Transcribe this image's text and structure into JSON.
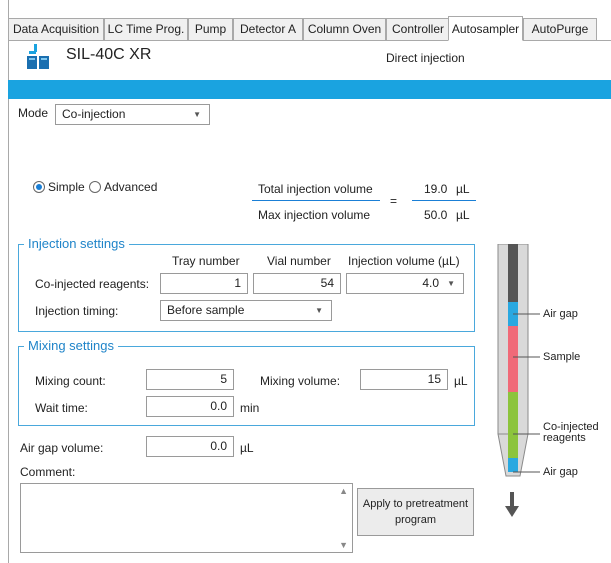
{
  "tabs": [
    "Data Acquisition",
    "LC Time Prog.",
    "Pump",
    "Detector A",
    "Column Oven",
    "Controller",
    "Autosampler",
    "AutoPurge"
  ],
  "device": {
    "name": "SIL-40C XR",
    "injection_mode": "Direct injection"
  },
  "mode": {
    "label": "Mode",
    "value": "Co-injection"
  },
  "method_type": {
    "simple_label": "Simple",
    "advanced_label": "Advanced",
    "selected": "Simple"
  },
  "volumes": {
    "total_label": "Total injection volume",
    "total_value": "19.0",
    "max_label": "Max injection volume",
    "max_value": "50.0",
    "unit": "µL",
    "equals": "="
  },
  "injection_settings": {
    "title": "Injection settings",
    "col_tray": "Tray number",
    "col_vial": "Vial number",
    "col_volume": "Injection volume (µL)",
    "coinj_label": "Co-injected reagents:",
    "tray_value": "1",
    "vial_value": "54",
    "volume_value": "4.0",
    "timing_label": "Injection timing:",
    "timing_value": "Before sample"
  },
  "mixing_settings": {
    "title": "Mixing settings",
    "count_label": "Mixing count:",
    "count_value": "5",
    "volume_label": "Mixing volume:",
    "volume_value": "15",
    "volume_unit": "µL",
    "wait_label": "Wait time:",
    "wait_value": "0.0",
    "wait_unit": "min"
  },
  "air_gap": {
    "label": "Air gap volume:",
    "value": "0.0",
    "unit": "µL"
  },
  "comment": {
    "label": "Comment:",
    "value": ""
  },
  "apply_button": {
    "line1": "Apply to pretreatment",
    "line2": "program"
  },
  "needle_legend": {
    "air_gap_top": "Air gap",
    "sample": "Sample",
    "coinj_line1": "Co-injected",
    "coinj_line2": "reagents",
    "air_gap_bottom": "Air gap"
  },
  "colors": {
    "accent_blue": "#1aa3e0",
    "air_gap": "#29a8e0",
    "sample": "#f06a78",
    "coinjected": "#8cc43c",
    "needle_dark": "#555555",
    "needle_light": "#d9d9d9"
  },
  "icons": {
    "device": "autosampler-device-icon",
    "dropdown": "chevron-down-icon",
    "flow": "down-arrow-icon"
  }
}
